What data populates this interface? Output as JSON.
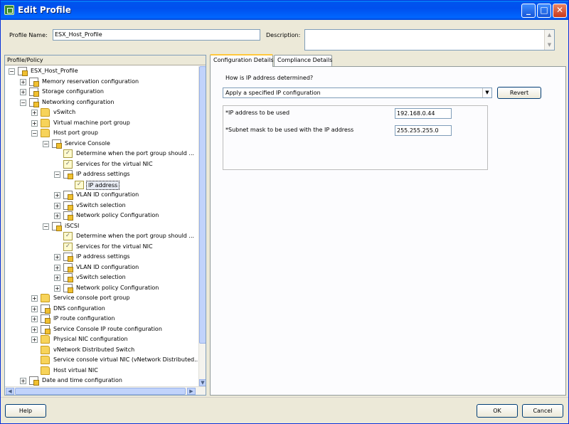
{
  "window": {
    "title": "Edit Profile"
  },
  "profile": {
    "name_label": "Profile Name:",
    "name_value": "ESX_Host_Profile",
    "description_label": "Description:",
    "description_value": ""
  },
  "tree": {
    "header": "Profile/Policy",
    "items": [
      {
        "label": "ESX_Host_Profile",
        "level": 0,
        "expander": "−",
        "icon": "profile-icon"
      },
      {
        "label": "Memory reservation configuration",
        "level": 1,
        "expander": "+",
        "icon": "profile-icon"
      },
      {
        "label": "Storage configuration",
        "level": 1,
        "expander": "+",
        "icon": "profile-icon"
      },
      {
        "label": "Networking configuration",
        "level": 1,
        "expander": "−",
        "icon": "profile-icon"
      },
      {
        "label": "vSwitch",
        "level": 2,
        "expander": "+",
        "icon": "folder-icon"
      },
      {
        "label": "Virtual machine port group",
        "level": 2,
        "expander": "+",
        "icon": "folder-icon"
      },
      {
        "label": "Host port group",
        "level": 2,
        "expander": "−",
        "icon": "folder-icon"
      },
      {
        "label": "Service Console",
        "level": 3,
        "expander": "−",
        "icon": "profile-icon"
      },
      {
        "label": "Determine when the port group should ...",
        "level": 4,
        "expander": "",
        "icon": "policy-icon"
      },
      {
        "label": "Services for the virtual NIC",
        "level": 4,
        "expander": "",
        "icon": "policy-icon"
      },
      {
        "label": "IP address settings",
        "level": 4,
        "expander": "−",
        "icon": "profile-icon"
      },
      {
        "label": "IP address",
        "level": 5,
        "expander": "",
        "icon": "policy-icon",
        "selected": true
      },
      {
        "label": "VLAN ID configuration",
        "level": 4,
        "expander": "+",
        "icon": "profile-icon"
      },
      {
        "label": "vSwitch selection",
        "level": 4,
        "expander": "+",
        "icon": "profile-icon"
      },
      {
        "label": "Network policy Configuration",
        "level": 4,
        "expander": "+",
        "icon": "profile-icon"
      },
      {
        "label": "iSCSI",
        "level": 3,
        "expander": "−",
        "icon": "profile-icon"
      },
      {
        "label": "Determine when the port group should ...",
        "level": 4,
        "expander": "",
        "icon": "policy-icon"
      },
      {
        "label": "Services for the virtual NIC",
        "level": 4,
        "expander": "",
        "icon": "policy-icon"
      },
      {
        "label": "IP address settings",
        "level": 4,
        "expander": "+",
        "icon": "profile-icon"
      },
      {
        "label": "VLAN ID configuration",
        "level": 4,
        "expander": "+",
        "icon": "profile-icon"
      },
      {
        "label": "vSwitch selection",
        "level": 4,
        "expander": "+",
        "icon": "profile-icon"
      },
      {
        "label": "Network policy Configuration",
        "level": 4,
        "expander": "+",
        "icon": "profile-icon"
      },
      {
        "label": "Service console port group",
        "level": 2,
        "expander": "+",
        "icon": "folder-icon"
      },
      {
        "label": "DNS configuration",
        "level": 2,
        "expander": "+",
        "icon": "profile-icon"
      },
      {
        "label": "IP route configuration",
        "level": 2,
        "expander": "+",
        "icon": "profile-icon"
      },
      {
        "label": "Service Console IP route configuration",
        "level": 2,
        "expander": "+",
        "icon": "profile-icon"
      },
      {
        "label": "Physical NIC configuration",
        "level": 2,
        "expander": "+",
        "icon": "folder-icon"
      },
      {
        "label": "vNetwork Distributed Switch",
        "level": 2,
        "expander": "",
        "icon": "folder-icon"
      },
      {
        "label": "Service console virtual NIC (vNetwork Distributed...",
        "level": 2,
        "expander": "",
        "icon": "folder-icon"
      },
      {
        "label": "Host virtual NIC",
        "level": 2,
        "expander": "",
        "icon": "folder-icon"
      },
      {
        "label": "Date and time configuration",
        "level": 1,
        "expander": "+",
        "icon": "profile-icon"
      }
    ]
  },
  "tabs": [
    {
      "label": "Configuration Details",
      "active": true
    },
    {
      "label": "Compliance Details",
      "active": false
    }
  ],
  "config": {
    "question": "How is IP address determined?",
    "selected_option": "Apply a specified IP configuration",
    "revert_label": "Revert",
    "ip_label": "*IP address to be used",
    "ip_value": "192.168.0.44",
    "mask_label": "*Subnet mask to be used with the IP address",
    "mask_value": "255.255.255.0"
  },
  "footer": {
    "help_label": "Help",
    "ok_label": "OK",
    "cancel_label": "Cancel"
  }
}
